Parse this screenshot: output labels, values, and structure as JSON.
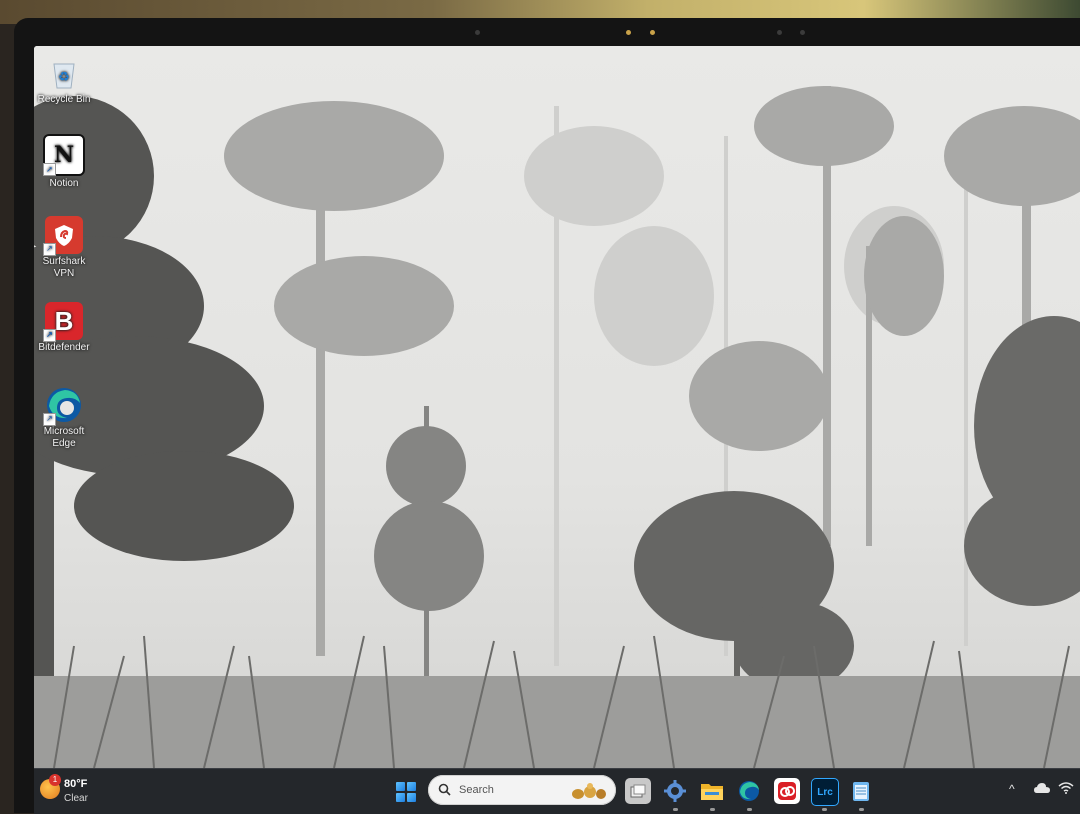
{
  "desktop": {
    "icons": [
      {
        "label": "Recycle Bin",
        "icon": "recycle-bin-icon"
      },
      {
        "label": "Notion",
        "icon": "notion-icon"
      },
      {
        "label": "Surfshark VPN",
        "icon": "surfshark-icon"
      },
      {
        "label": "Bitdefender",
        "icon": "bitdefender-icon"
      },
      {
        "label": "Microsoft Edge",
        "icon": "edge-icon"
      }
    ],
    "wallpaper": "misty-forest-black-and-white"
  },
  "taskbar": {
    "weather": {
      "temp": "80°F",
      "condition": "Clear",
      "badge": "1"
    },
    "search": {
      "placeholder": "Search"
    },
    "apps": [
      {
        "name": "start-button",
        "icon": "windows-logo-icon"
      },
      {
        "name": "task-view",
        "icon": "task-view-icon"
      },
      {
        "name": "settings",
        "icon": "gear-icon"
      },
      {
        "name": "file-explorer",
        "icon": "folder-icon"
      },
      {
        "name": "edge",
        "icon": "edge-icon"
      },
      {
        "name": "creative-cloud",
        "icon": "creative-cloud-icon"
      },
      {
        "name": "lightroom-classic",
        "icon": "lightroom-icon",
        "label": "Lrc"
      },
      {
        "name": "notepad",
        "icon": "notepad-icon"
      }
    ],
    "tray": {
      "chevron": "^",
      "icons": [
        "onedrive-cloud-icon",
        "wifi-icon"
      ]
    }
  },
  "colors": {
    "taskbar_bg": "#24272b",
    "accent": "#1e7fe0",
    "surfshark_red": "#d63a2e",
    "bitdefender_red": "#d9262b",
    "lightroom_bg": "#001e36"
  }
}
